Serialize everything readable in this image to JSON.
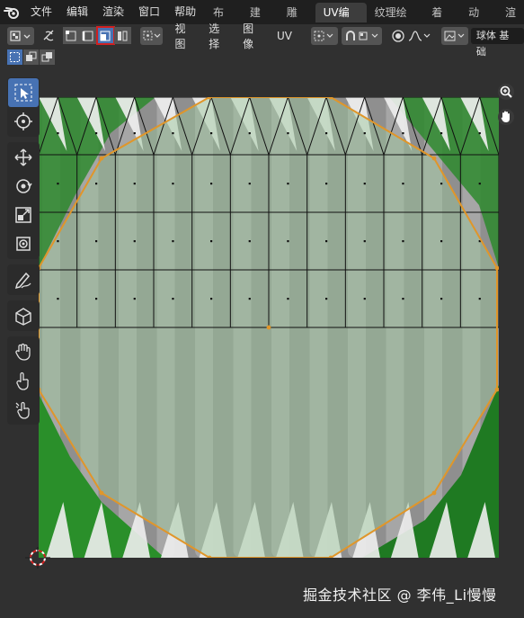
{
  "menubar": {
    "menus": [
      "文件",
      "编辑",
      "渲染",
      "窗口",
      "帮助"
    ],
    "workspace_tabs": [
      "布局",
      "建模",
      "雕刻",
      "UV编辑",
      "纹理绘制",
      "着色",
      "动画",
      "渲"
    ],
    "active_tab": "UV编辑"
  },
  "header": {
    "menus": [
      "视图",
      "选择",
      "图像",
      "UV"
    ],
    "image_name": "球体 基础",
    "icons": [
      "uv-editor-type-icon",
      "sync-selection-icon",
      "vertex-select-icon",
      "edge-select-icon",
      "face-select-icon",
      "island-select-icon",
      "sticky-mode-icon",
      "pivot-icon",
      "snap-icon",
      "proportional-icon",
      "falloff-icon",
      "image-browse-icon"
    ]
  },
  "selection_modes_row": [
    "select-set-icon",
    "select-extend-icon",
    "select-subtract-icon"
  ],
  "toolbar": {
    "tools": [
      "select-box-icon",
      "cursor-icon",
      "move-icon",
      "rotate-icon",
      "scale-icon",
      "transform-icon",
      "annotate-icon",
      "rip-icon",
      "grab-icon",
      "relax-icon",
      "pinch-icon"
    ]
  },
  "navigation": [
    "zoom-icon",
    "pan-hand-icon"
  ],
  "colors": {
    "accent": "#4772b3",
    "selection_outline": "#e0962a",
    "highlight_border": "#d02020"
  },
  "watermark": "掘金技术社区 @ 李伟_Li慢慢"
}
